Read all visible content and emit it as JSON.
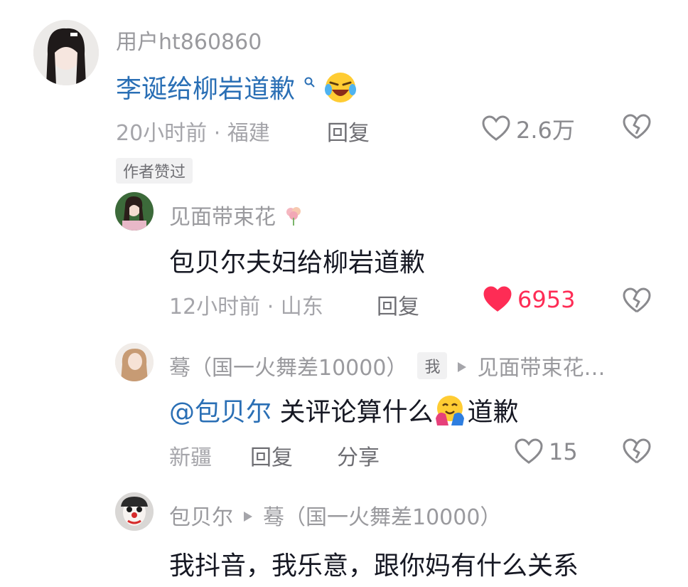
{
  "comments": [
    {
      "username": "用户ht860860",
      "text": "李诞给柳岩道歉",
      "time": "20小时前 · 福建",
      "reply_label": "回复",
      "likes": "2.6万",
      "liked": false,
      "author_badge": "作者赞过"
    },
    {
      "username": "见面带束花",
      "text": "包贝尔夫妇给柳岩道歉",
      "time": "12小时前 · 山东",
      "reply_label": "回复",
      "likes": "6953",
      "liked": true
    },
    {
      "username": "蓦（国一火舞差10000）",
      "me_badge": "我",
      "reply_to": "见面带束花…",
      "mention": "@包贝尔",
      "text_a": " 关评论算什么",
      "text_b": "道歉",
      "time": "新疆",
      "reply_label": "回复",
      "share_label": "分享",
      "likes": "15",
      "liked": false
    },
    {
      "username": "包贝尔",
      "reply_to": "蓦（国一火舞差10000）",
      "text": "我抖音，我乐意，跟你妈有什么关系"
    }
  ],
  "colors": {
    "liked": "#fe2c55",
    "mention": "#2a6fb5",
    "muted": "#a5a5aa"
  },
  "icons": [
    "heart-icon",
    "dislike-heart-icon",
    "search-icon",
    "laughing-emoji",
    "hug-emoji",
    "flower-emoji",
    "play-arrow-icon"
  ]
}
